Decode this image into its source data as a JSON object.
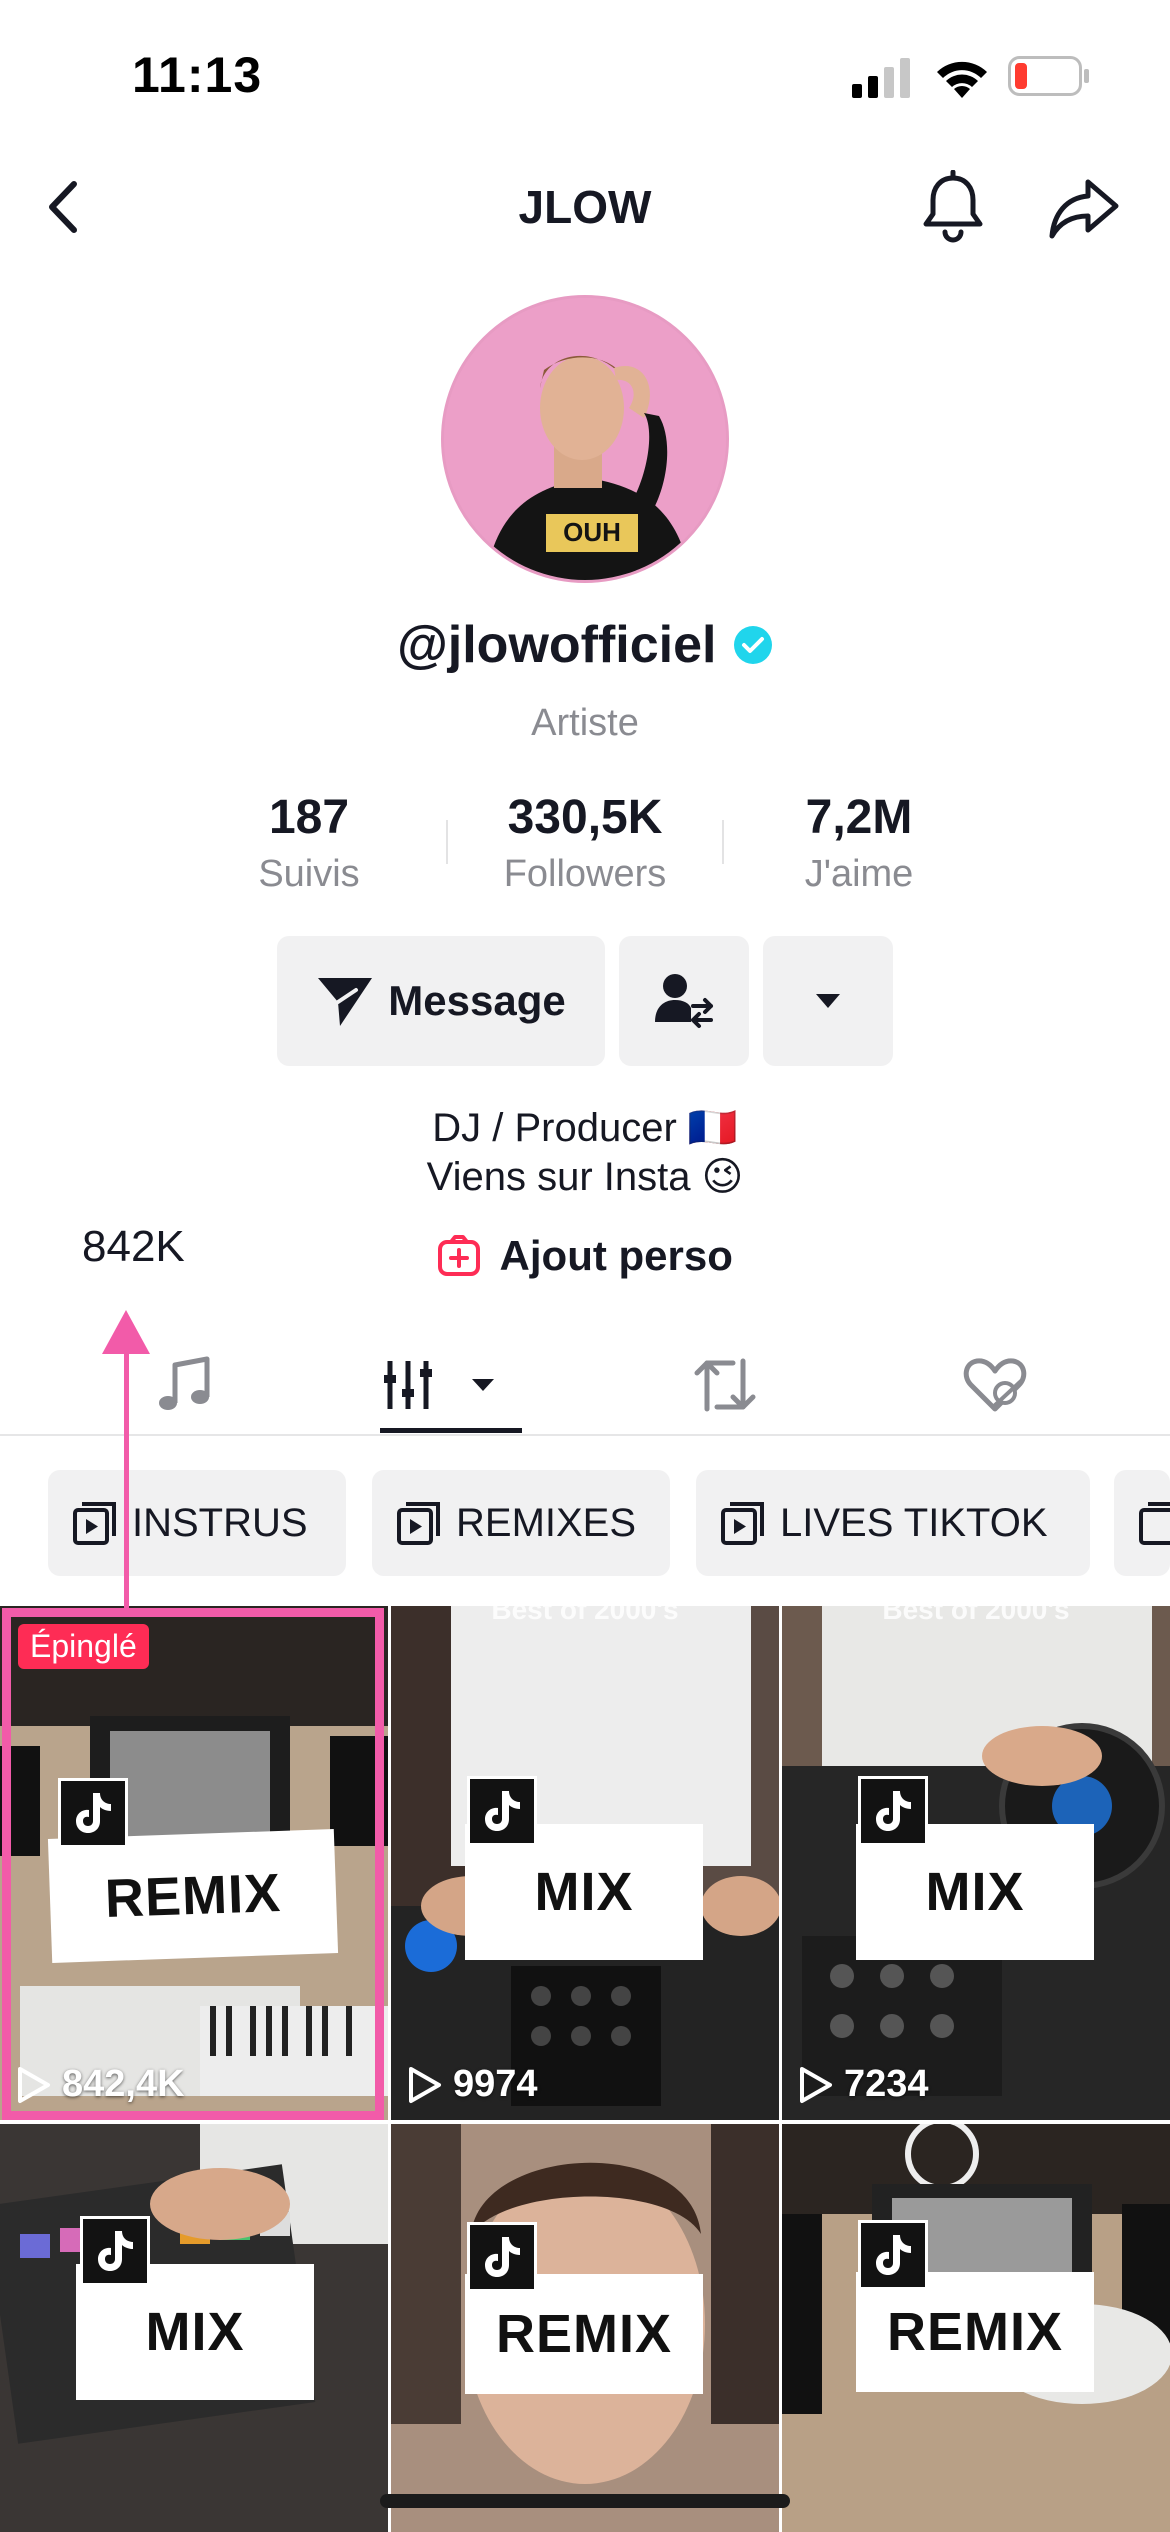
{
  "status_bar": {
    "time": "11:13"
  },
  "header": {
    "title": "JLOW"
  },
  "profile": {
    "username": "@jlowofficiel",
    "category": "Artiste",
    "avatar_text": "OUH"
  },
  "stats": [
    {
      "value": "187",
      "label": "Suivis"
    },
    {
      "value": "330,5K",
      "label": "Followers"
    },
    {
      "value": "7,2M",
      "label": "J'aime"
    }
  ],
  "actions": {
    "message_label": "Message"
  },
  "bio": {
    "line1": "DJ / Producer 🇫🇷",
    "line2": "Viens sur Insta 😉",
    "link_label": "Ajout perso"
  },
  "annotation": {
    "text": "842K"
  },
  "playlists": [
    {
      "label": "INSTRUS"
    },
    {
      "label": "REMIXES"
    },
    {
      "label": "LIVES TIKTOK"
    }
  ],
  "videos": [
    {
      "card_label": "REMIX",
      "views": "842,4K",
      "pinned_label": "Épinglé"
    },
    {
      "card_label": "MIX",
      "views": "9974",
      "caption": "Best of 2000's"
    },
    {
      "card_label": "MIX",
      "views": "7234",
      "caption": "Best of 2000's"
    },
    {
      "card_label": "MIX"
    },
    {
      "card_label": "REMIX"
    },
    {
      "card_label": "REMIX"
    }
  ],
  "colors": {
    "accent_pink": "#f25ba9",
    "pinned_red": "#fe2c55",
    "verified": "#20d5ec",
    "chip_bg": "#f1f1f2"
  }
}
